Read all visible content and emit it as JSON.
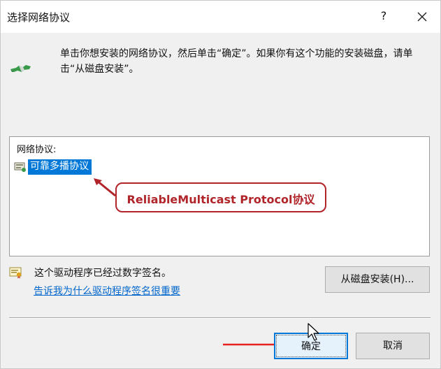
{
  "window": {
    "title": "选择网络协议",
    "help_label": "?"
  },
  "intro": {
    "text": "单击你想安装的网络协议，然后单击“确定”。如果你有这个功能的安装磁盘，请单击“从磁盘安装”。",
    "icon": "network-cable-icon"
  },
  "protocol_list": {
    "header": "网络协议:",
    "items": [
      {
        "label": "可靠多播协议",
        "selected": true,
        "icon": "protocol-icon"
      }
    ]
  },
  "annotation": {
    "text": "ReliableMulticast Protocol协议",
    "color": "#b0242a"
  },
  "driver": {
    "signed_text": "这个驱动程序已经过数字签名。",
    "link_text": "告诉我为什么驱动程序签名很重要"
  },
  "buttons": {
    "install_from_disk": "从磁盘安装(H)...",
    "ok": "确定",
    "cancel": "取消"
  },
  "colors": {
    "selection": "#0078d7",
    "link": "#0066cc",
    "accent_red": "#e8221e",
    "dialog_bg": "#f0f0f0"
  }
}
